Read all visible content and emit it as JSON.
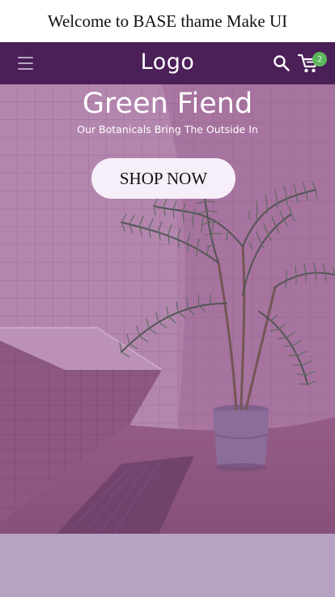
{
  "announcement": {
    "text": "Welcome to BASE thame Make UI"
  },
  "header": {
    "logo_text": "Logo",
    "menu_icon": "hamburger-menu-icon",
    "search_icon": "search-icon",
    "cart_icon": "shopping-cart-icon",
    "cart_count": "2",
    "background_color": "#4b1f58",
    "badge_color": "#5cb85c"
  },
  "hero": {
    "title": "Green Fiend",
    "subtitle": "Our Botanicals Bring The Outside In",
    "cta_label": "SHOP NOW",
    "overlay_color": "#8a4a92",
    "cta_background": "#f6eef8"
  },
  "section_below": {
    "background_color": "#b8a2c4"
  }
}
